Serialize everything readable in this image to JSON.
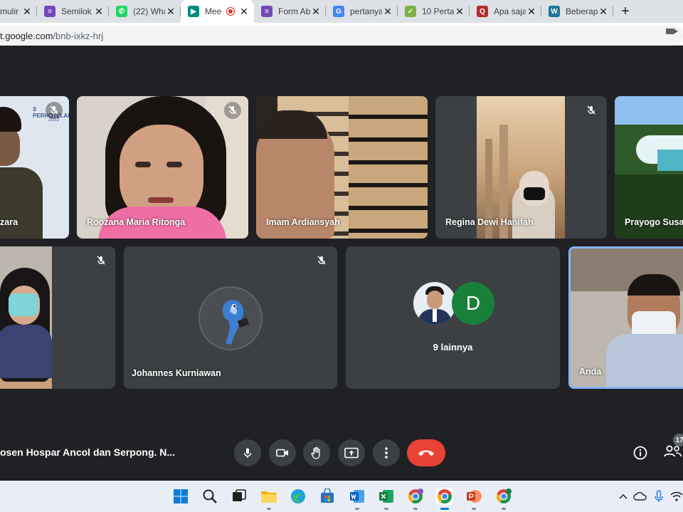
{
  "browser": {
    "tabs": [
      {
        "title": "mulir",
        "favicon": "forms-icon",
        "color": "#7248b9",
        "active": false
      },
      {
        "title": "Semilok",
        "favicon": "forms-icon",
        "color": "#7248b9",
        "active": false
      },
      {
        "title": "(22) Wha",
        "favicon": "whatsapp-icon",
        "color": "#25d366",
        "active": false
      },
      {
        "title": "Mee",
        "favicon": "meet-icon",
        "color": "#00897b",
        "active": true
      },
      {
        "title": "Form Ab",
        "favicon": "forms-icon",
        "color": "#7248b9",
        "active": false
      },
      {
        "title": "pertanya",
        "favicon": "google-icon",
        "color": "#4285f4",
        "active": false
      },
      {
        "title": "10 Perta",
        "favicon": "leaf-icon",
        "color": "#7cb342",
        "active": false
      },
      {
        "title": "Apa saja",
        "favicon": "quora-icon",
        "color": "#b92b27",
        "active": false
      },
      {
        "title": "Beberap",
        "favicon": "wordpress-icon",
        "color": "#21759b",
        "active": false
      }
    ],
    "new_tab_label": "+",
    "url_host": "t.google.com",
    "url_path": "/bnb-ixkz-hrj"
  },
  "participants_top": [
    {
      "name": "zara",
      "muted": true
    },
    {
      "name": "Roozana Maria Ritonga",
      "muted": true
    },
    {
      "name": "Imam Ardiansyah",
      "muted": false
    },
    {
      "name": "Regina Dewi Hanifah",
      "muted": true
    },
    {
      "name": "Prayogo Susa",
      "muted": false
    }
  ],
  "participants_bottom": [
    {
      "name": "",
      "muted": true
    },
    {
      "name": "Johannes Kurniawan",
      "muted": true
    },
    {
      "name": "",
      "others_label": "9 lainnya",
      "avatar_letter": "D",
      "avatar_color": "#188038"
    },
    {
      "name": "Anda",
      "muted": false
    }
  ],
  "tile_backdrop_text": "S PERHOTELAN",
  "tile_backdrop_year": "2022",
  "meeting": {
    "title": "osen Hospar Ancol dan Serpong. N...",
    "participant_count": "17"
  },
  "colors": {
    "end_call": "#ea4335",
    "self_border": "#8ab4f8",
    "control_bg": "#3c4043"
  }
}
